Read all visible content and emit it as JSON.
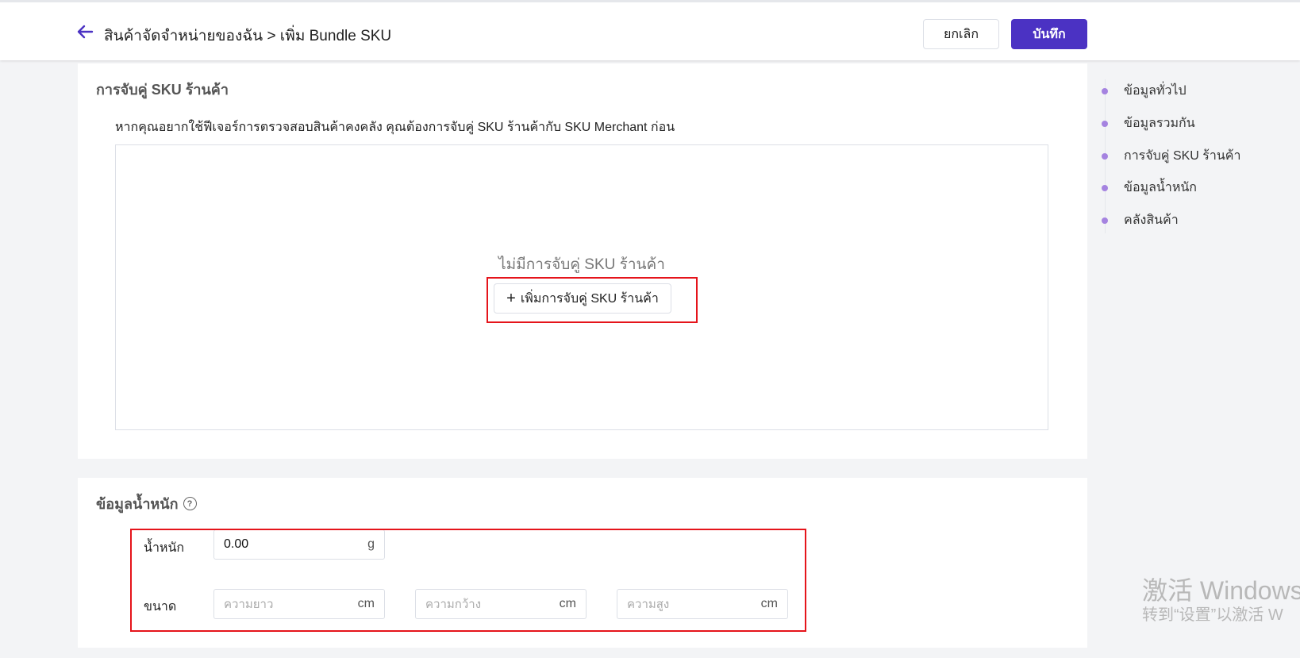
{
  "header": {
    "breadcrumb": "สินค้าจัดจำหน่ายของฉัน > เพิ่ม Bundle SKU",
    "cancel_label": "ยกเลิก",
    "save_label": "บันทึก"
  },
  "sku_pairing": {
    "title": "การจับคู่ SKU ร้านค้า",
    "description": "หากคุณอยากใช้ฟีเจอร์การตรวจสอบสินค้าคงคลัง คุณต้องการจับคู่ SKU ร้านค้ากับ SKU Merchant ก่อน",
    "empty_text": "ไม่มีการจับคู่ SKU ร้านค้า",
    "add_button_label": "เพิ่มการจับคู่ SKU ร้านค้า"
  },
  "weight_info": {
    "title": "ข้อมูลน้ำหนัก",
    "help_icon": "?",
    "weight_label": "น้ำหนัก",
    "weight_value": "0.00",
    "weight_unit": "g",
    "size_label": "ขนาด",
    "length_placeholder": "ความยาว",
    "width_placeholder": "ความกว้าง",
    "height_placeholder": "ความสูง",
    "dim_unit": "cm"
  },
  "side_nav": {
    "items": [
      {
        "label": "ข้อมูลทั่วไป"
      },
      {
        "label": "ข้อมูลรวมกัน"
      },
      {
        "label": "การจับคู่ SKU ร้านค้า"
      },
      {
        "label": "ข้อมูลน้ำหนัก"
      },
      {
        "label": "คลังสินค้า"
      }
    ]
  },
  "watermark": {
    "line1": "激活 Windows",
    "line2": "转到“设置”以激活 W"
  },
  "colors": {
    "primary": "#4b32c3",
    "nav_dot": "#a583e0",
    "highlight": "#e5141b"
  }
}
